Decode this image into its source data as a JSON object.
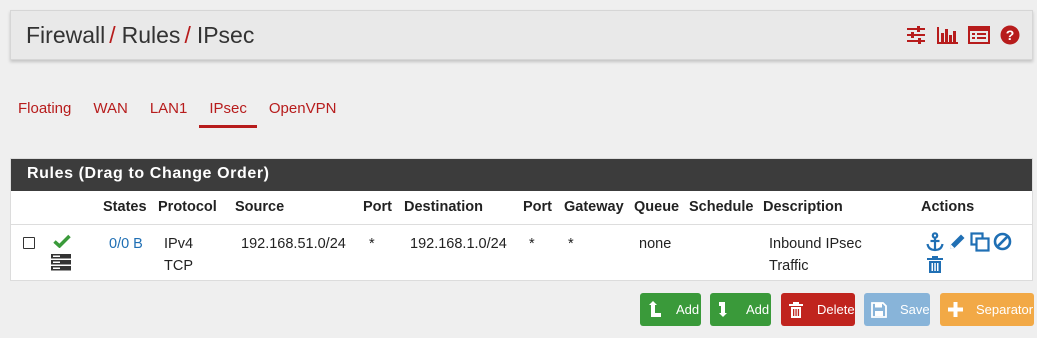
{
  "breadcrumb": {
    "items": [
      "Firewall",
      "Rules",
      "IPsec"
    ],
    "separator": "/"
  },
  "header_icons": [
    "sliders-icon",
    "bar-chart-icon",
    "table-icon",
    "help-icon"
  ],
  "tabs": [
    {
      "label": "Floating",
      "active": false
    },
    {
      "label": "WAN",
      "active": false
    },
    {
      "label": "LAN1",
      "active": false
    },
    {
      "label": "IPsec",
      "active": true
    },
    {
      "label": "OpenVPN",
      "active": false
    }
  ],
  "panel": {
    "title": "Rules (Drag to Change Order)"
  },
  "table": {
    "columns": [
      "States",
      "Protocol",
      "Source",
      "Port",
      "Destination",
      "Port",
      "Gateway",
      "Queue",
      "Schedule",
      "Description",
      "Actions"
    ],
    "rows": [
      {
        "states": "0/0 B",
        "protocol_line1": "IPv4",
        "protocol_line2": "TCP",
        "source": "192.168.51.0/24",
        "source_port": "*",
        "destination": "192.168.1.0/24",
        "dest_port": "*",
        "gateway": "*",
        "queue": "none",
        "schedule": "",
        "description_line1": "Inbound IPsec",
        "description_line2": "Traffic",
        "status_icons": [
          "check-icon",
          "server-icon"
        ],
        "action_icons": [
          "anchor-icon",
          "pencil-icon",
          "copy-icon",
          "disable-icon",
          "trash-icon"
        ]
      }
    ]
  },
  "buttons": {
    "add_top": "Add",
    "add_bottom": "Add",
    "delete": "Delete",
    "save": "Save",
    "separator": "Separator"
  },
  "colors": {
    "accent_red": "#b71c1c",
    "panel_header": "#3c3c3c",
    "link_blue": "#1f6fb4",
    "success_green": "#3a9a3a",
    "danger_red": "#c0241e",
    "save_blue": "#88b4d9",
    "warning_orange": "#f2a946"
  }
}
